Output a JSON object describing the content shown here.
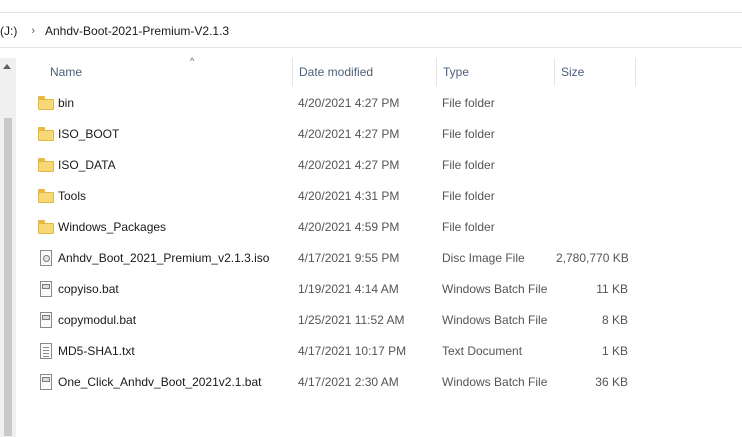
{
  "address": {
    "previous": "(J:)",
    "separator": "›",
    "current": "Anhdv-Boot-2021-Premium-V2.1.3"
  },
  "columns": {
    "name": "Name",
    "date": "Date modified",
    "type": "Type",
    "size": "Size",
    "sort_indicator": "^"
  },
  "files": [
    {
      "name": "bin",
      "date": "4/20/2021 4:27 PM",
      "type": "File folder",
      "size": "",
      "icon": "folder-icon"
    },
    {
      "name": "ISO_BOOT",
      "date": "4/20/2021 4:27 PM",
      "type": "File folder",
      "size": "",
      "icon": "folder-icon"
    },
    {
      "name": "ISO_DATA",
      "date": "4/20/2021 4:27 PM",
      "type": "File folder",
      "size": "",
      "icon": "folder-icon"
    },
    {
      "name": "Tools",
      "date": "4/20/2021 4:31 PM",
      "type": "File folder",
      "size": "",
      "icon": "folder-icon"
    },
    {
      "name": "Windows_Packages",
      "date": "4/20/2021 4:59 PM",
      "type": "File folder",
      "size": "",
      "icon": "folder-icon"
    },
    {
      "name": "Anhdv_Boot_2021_Premium_v2.1.3.iso",
      "date": "4/17/2021 9:55 PM",
      "type": "Disc Image File",
      "size": "2,780,770 KB",
      "icon": "disc-image-icon"
    },
    {
      "name": "copyiso.bat",
      "date": "1/19/2021 4:14 AM",
      "type": "Windows Batch File",
      "size": "11 KB",
      "icon": "batch-file-icon"
    },
    {
      "name": "copymodul.bat",
      "date": "1/25/2021 11:52 AM",
      "type": "Windows Batch File",
      "size": "8 KB",
      "icon": "batch-file-icon"
    },
    {
      "name": "MD5-SHA1.txt",
      "date": "4/17/2021 10:17 PM",
      "type": "Text Document",
      "size": "1 KB",
      "icon": "text-file-icon"
    },
    {
      "name": "One_Click_Anhdv_Boot_2021v2.1.bat",
      "date": "4/17/2021 2:30 AM",
      "type": "Windows Batch File",
      "size": "36 KB",
      "icon": "batch-file-icon"
    }
  ]
}
